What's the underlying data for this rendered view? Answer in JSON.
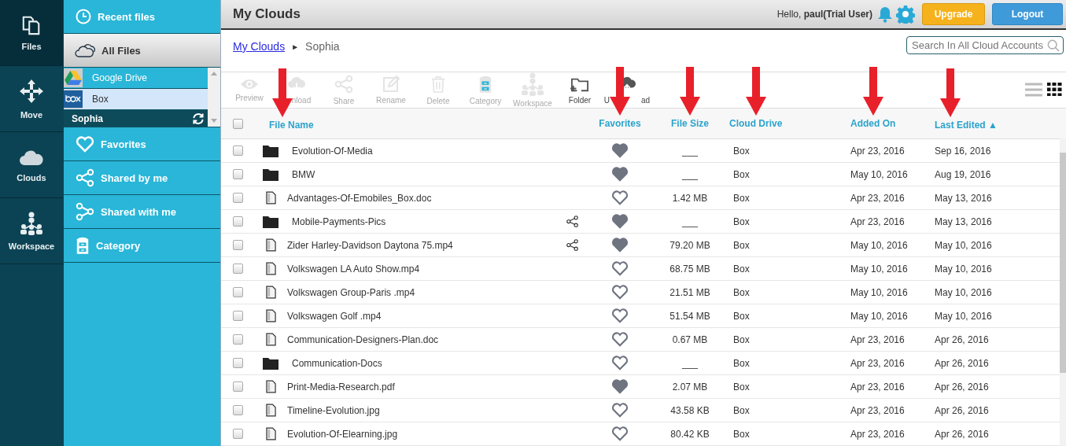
{
  "nav": [
    {
      "label": "Files",
      "selected": true
    },
    {
      "label": "Move",
      "selected": false
    },
    {
      "label": "Clouds",
      "selected": false
    },
    {
      "label": "Workspace",
      "selected": false
    }
  ],
  "sidebar": {
    "items": [
      {
        "label": "Recent files",
        "selected": false
      },
      {
        "label": "All Files",
        "selected": true
      },
      {
        "label": "Favorites",
        "selected": false
      },
      {
        "label": "Shared by me",
        "selected": false
      },
      {
        "label": "Shared with me",
        "selected": false
      },
      {
        "label": "Category",
        "selected": false
      }
    ],
    "clouds": [
      {
        "label": "Google Drive",
        "selected": false
      },
      {
        "label": "Box",
        "selected": true,
        "children": [
          {
            "label": "Sophia"
          }
        ]
      }
    ]
  },
  "header": {
    "title": "My Clouds",
    "greeting": "Hello, ",
    "user": "paul(Trial User)",
    "buttons": [
      {
        "label": "Upgrade"
      },
      {
        "label": "Logout"
      }
    ]
  },
  "breadcrumb": [
    {
      "label": "My Clouds",
      "kind": "link"
    },
    {
      "label": "►",
      "kind": "separator"
    },
    {
      "label": "Sophia",
      "kind": "current"
    }
  ],
  "search": {
    "placeholder": "Search In All Cloud Accounts"
  },
  "toolbar": [
    {
      "label": "Preview",
      "disabled": true
    },
    {
      "label": "nload",
      "disabled": true
    },
    {
      "label": "Share",
      "disabled": true
    },
    {
      "label": "Rename",
      "disabled": true
    },
    {
      "label": "Delete",
      "disabled": true
    },
    {
      "label": "Category",
      "disabled": true
    },
    {
      "label": "Workspace",
      "disabled": true
    },
    {
      "label": "Folder",
      "disabled": false
    },
    {
      "label": "U",
      "label_end": "ad",
      "disabled": false
    }
  ],
  "view_modes": [
    {
      "selected": false
    },
    {
      "selected": true
    }
  ],
  "table": {
    "select_all": {
      "checked": false
    },
    "columns": [
      {
        "label": "File Name",
        "marked": true
      },
      {
        "label": "Favorites",
        "marked": true
      },
      {
        "label": "File Size",
        "marked": true
      },
      {
        "label": "Cloud Drive",
        "marked": true
      },
      {
        "label": "Added On",
        "marked": true
      },
      {
        "label": "Last Edited ▲",
        "marked": true
      }
    ],
    "rows": [
      {
        "kind": "folder",
        "name": "Evolution-Of-Media",
        "shared": false,
        "favorite": true,
        "size": "___",
        "drive": "Box",
        "added": "Apr 23, 2016",
        "edited": "Sep 16, 2016",
        "checked": false
      },
      {
        "kind": "folder",
        "name": "BMW",
        "shared": false,
        "favorite": true,
        "size": "___",
        "drive": "Box",
        "added": "May 10, 2016",
        "edited": "Aug 19, 2016",
        "checked": false
      },
      {
        "kind": "file",
        "name": "Advantages-Of-Emobiles_Box.doc",
        "shared": false,
        "favorite": false,
        "size": "1.42 MB",
        "drive": "Box",
        "added": "Apr 23, 2016",
        "edited": "May 13, 2016",
        "checked": false
      },
      {
        "kind": "folder",
        "name": "Mobile-Payments-Pics",
        "shared": true,
        "favorite": true,
        "size": "___",
        "drive": "Box",
        "added": "Apr 23, 2016",
        "edited": "May 13, 2016",
        "checked": false
      },
      {
        "kind": "file",
        "name": "Zider Harley-Davidson Daytona 75.mp4",
        "shared": true,
        "favorite": true,
        "size": "79.20 MB",
        "drive": "Box",
        "added": "May 10, 2016",
        "edited": "May 10, 2016",
        "checked": false
      },
      {
        "kind": "file",
        "name": "Volkswagen LA Auto Show.mp4",
        "shared": false,
        "favorite": false,
        "size": "68.75 MB",
        "drive": "Box",
        "added": "May 10, 2016",
        "edited": "May 10, 2016",
        "checked": false
      },
      {
        "kind": "file",
        "name": "Volkswagen Group-Paris .mp4",
        "shared": false,
        "favorite": false,
        "size": "21.51 MB",
        "drive": "Box",
        "added": "May 10, 2016",
        "edited": "May 10, 2016",
        "checked": false
      },
      {
        "kind": "file",
        "name": "Volkswagen Golf .mp4",
        "shared": false,
        "favorite": false,
        "size": "51.54 MB",
        "drive": "Box",
        "added": "May 10, 2016",
        "edited": "May 10, 2016",
        "checked": false
      },
      {
        "kind": "file",
        "name": "Communication-Designers-Plan.doc",
        "shared": false,
        "favorite": false,
        "size": "0.67 MB",
        "drive": "Box",
        "added": "Apr 23, 2016",
        "edited": "Apr 26, 2016",
        "checked": false
      },
      {
        "kind": "folder",
        "name": "Communication-Docs",
        "shared": false,
        "favorite": false,
        "size": "___",
        "drive": "Box",
        "added": "Apr 23, 2016",
        "edited": "Apr 26, 2016",
        "checked": false
      },
      {
        "kind": "file",
        "name": "Print-Media-Research.pdf",
        "shared": false,
        "favorite": true,
        "size": "2.07 MB",
        "drive": "Box",
        "added": "Apr 23, 2016",
        "edited": "Apr 26, 2016",
        "checked": false
      },
      {
        "kind": "file",
        "name": "Timeline-Evolution.jpg",
        "shared": false,
        "favorite": false,
        "size": "43.58 KB",
        "drive": "Box",
        "added": "Apr 23, 2016",
        "edited": "Apr 26, 2016",
        "checked": false
      },
      {
        "kind": "file",
        "name": "Evolution-Of-Elearning.jpg",
        "shared": false,
        "favorite": false,
        "size": "80.42 KB",
        "drive": "Box",
        "added": "Apr 23, 2016",
        "edited": "Apr 26, 2016",
        "checked": false
      }
    ]
  }
}
